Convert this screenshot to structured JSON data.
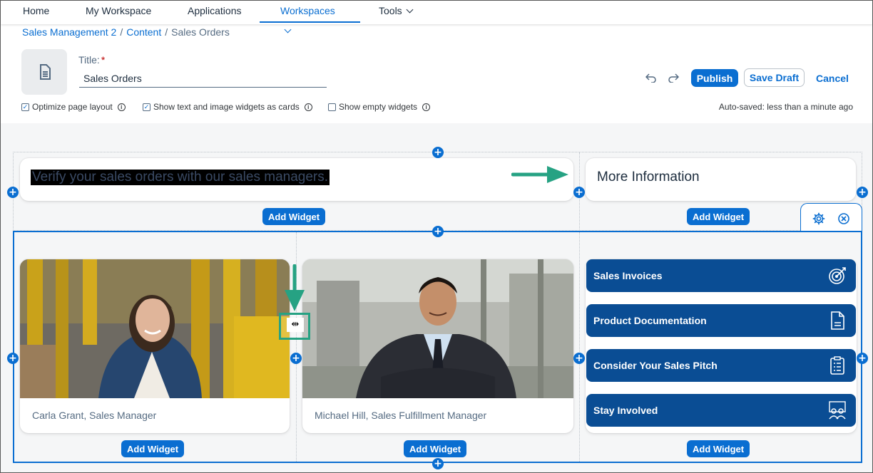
{
  "nav": {
    "items": [
      {
        "label": "Home"
      },
      {
        "label": "My Workspace"
      },
      {
        "label": "Applications"
      },
      {
        "label": "Workspaces"
      },
      {
        "label": "Tools"
      }
    ],
    "active_index": 3
  },
  "breadcrumb": [
    "Sales Management 2",
    "Content",
    "Sales Orders"
  ],
  "page": {
    "title_label": "Title:",
    "required_marker": "*",
    "title_value": "Sales Orders"
  },
  "actions": {
    "publish": "Publish",
    "save_draft": "Save Draft",
    "cancel": "Cancel"
  },
  "options": [
    {
      "label": "Optimize page layout",
      "checked": true
    },
    {
      "label": "Show text and image widgets as cards",
      "checked": true
    },
    {
      "label": "Show empty widgets",
      "checked": false
    }
  ],
  "autosave": "Auto-saved: less than a minute ago",
  "section1": {
    "text_widget": "Verify your sales orders with our sales managers.",
    "more_info": "More Information",
    "add_widget": "Add Widget"
  },
  "section2": {
    "add_widget": "Add Widget",
    "people": [
      {
        "caption": "Carla Grant, Sales Manager"
      },
      {
        "caption": "Michael Hill, Sales Fulfillment Manager"
      }
    ],
    "links": [
      {
        "label": "Sales Invoices",
        "icon": "target-icon"
      },
      {
        "label": "Product Documentation",
        "icon": "document-icon"
      },
      {
        "label": "Consider Your Sales Pitch",
        "icon": "clipboard-icon"
      },
      {
        "label": "Stay Involved",
        "icon": "group-icon"
      }
    ]
  },
  "colors": {
    "accent": "#0a6ed1",
    "tile": "#0a4d94",
    "annotation": "#26a283"
  }
}
